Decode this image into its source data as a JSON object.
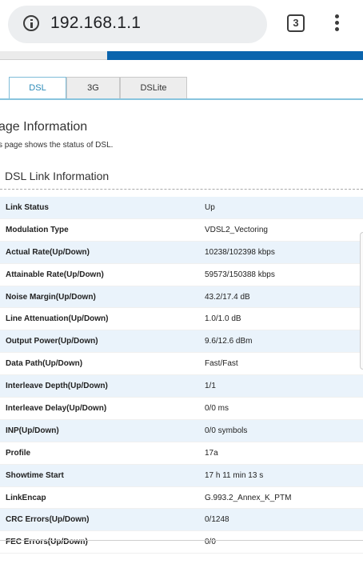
{
  "browser": {
    "url": "192.168.1.1",
    "tab_count": "3"
  },
  "tabs": [
    {
      "label": "DSL",
      "active": true
    },
    {
      "label": "3G",
      "active": false
    },
    {
      "label": "DSLite",
      "active": false
    }
  ],
  "page": {
    "title": "age Information",
    "description": "s page shows the status of DSL."
  },
  "section": {
    "title": "DSL Link Information"
  },
  "rows": [
    {
      "label": "Link Status",
      "value": "Up"
    },
    {
      "label": "Modulation Type",
      "value": "VDSL2_Vectoring"
    },
    {
      "label": "Actual Rate(Up/Down)",
      "value": "10238/102398 kbps"
    },
    {
      "label": "Attainable Rate(Up/Down)",
      "value": "59573/150388 kbps"
    },
    {
      "label": "Noise Margin(Up/Down)",
      "value": "43.2/17.4 dB"
    },
    {
      "label": "Line Attenuation(Up/Down)",
      "value": "1.0/1.0 dB"
    },
    {
      "label": "Output Power(Up/Down)",
      "value": "9.6/12.6 dBm"
    },
    {
      "label": "Data Path(Up/Down)",
      "value": "Fast/Fast"
    },
    {
      "label": "Interleave Depth(Up/Down)",
      "value": "1/1"
    },
    {
      "label": "Interleave Delay(Up/Down)",
      "value": "0/0 ms"
    },
    {
      "label": "INP(Up/Down)",
      "value": "0/0 symbols"
    },
    {
      "label": "Profile",
      "value": "17a"
    },
    {
      "label": "Showtime Start",
      "value": "17 h 11 min 13 s"
    },
    {
      "label": "LinkEncap",
      "value": "G.993.2_Annex_K_PTM"
    },
    {
      "label": "CRC Errors(Up/Down)",
      "value": "0/1248"
    },
    {
      "label": "FEC Errors(Up/Down)",
      "value": "0/0"
    }
  ],
  "colors": {
    "accent_blue": "#0a64ad",
    "tab_active_text": "#2a8ab8",
    "row_stripe": "#eaf3fb"
  }
}
